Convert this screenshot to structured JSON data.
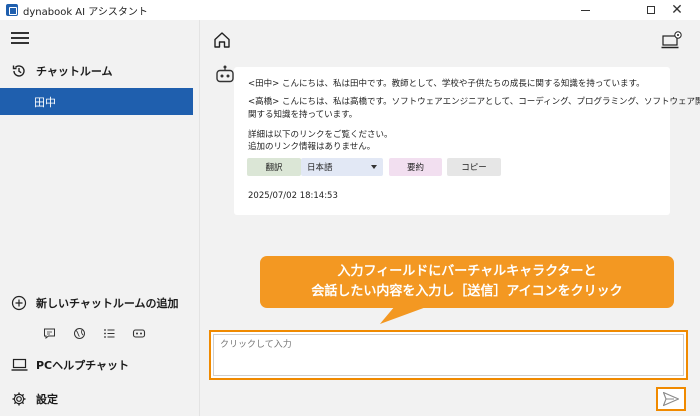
{
  "window": {
    "title": "dynabook AI アシスタント",
    "minimize_label": "",
    "maximize_label": "",
    "close_label": "✕"
  },
  "sidebar": {
    "chatroom_label": "チャットルーム",
    "rooms": [
      {
        "label": "田中",
        "selected": true
      }
    ],
    "add_room_label": "新しいチャットルームの追加",
    "pc_help_label": "PCヘルプチャット",
    "settings_label": "設定",
    "quick_icons": [
      "chat-bubble-icon",
      "globe-icon",
      "list-icon",
      "robot-icon"
    ]
  },
  "chat": {
    "messages": [
      "<田中> こんにちは、私は田中です。教師として、学校や子供たちの成長に関する知識を持っています。",
      "<高橋> こんにちは、私は高橋です。ソフトウェアエンジニアとして、コーディング、プログラミング、ソフトウェア開発に",
      "関する知識を持っています。",
      "詳細は以下のリンクをご覧ください。",
      "追加のリンク情報はありません。"
    ],
    "actions": {
      "translate": "翻訳",
      "language": "日本語",
      "summary": "要約",
      "copy": "コピー"
    },
    "timestamp": "2025/07/02 18:14:53"
  },
  "callout": {
    "line1": "入力フィールドにバーチャルキャラクターと",
    "line2": "会話したい内容を入力し［送信］アイコンをクリック"
  },
  "input": {
    "placeholder": "クリックして入力",
    "value": ""
  },
  "colors": {
    "accent": "#1f5fae",
    "highlight": "#f08a00",
    "callout": "#f39822"
  }
}
